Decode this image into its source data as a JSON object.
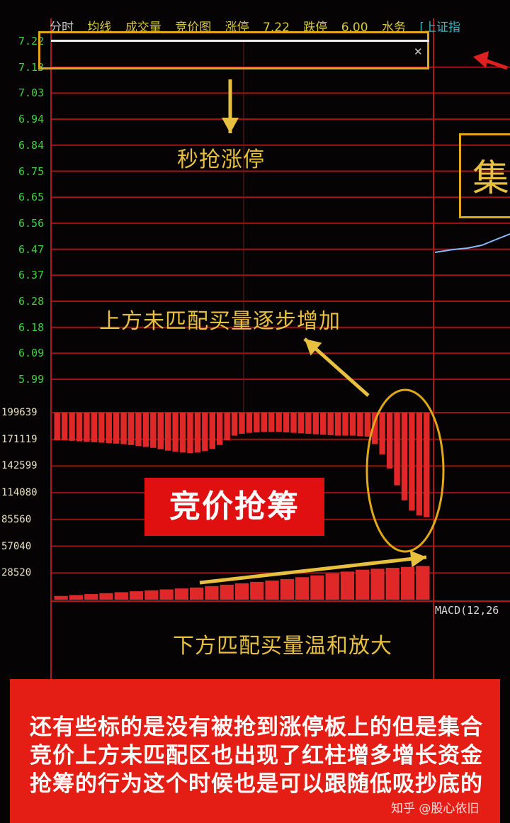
{
  "toolbar": {
    "items": [
      "分时",
      "均线",
      "成交量",
      "竞价图",
      "涨停",
      "7.22",
      "跌停",
      "6.00",
      "水务",
      "[上证指"
    ],
    "first_item": "分时"
  },
  "annotations": {
    "top": "秒抢涨停",
    "middle": "上方未匹配买量逐步增加",
    "bottom": "下方匹配买量温和放大",
    "red_label": "竞价抢筹",
    "right_box": "集"
  },
  "macd_label": "MACD(12,26",
  "caption": [
    "还有些标的是没有被抢到涨停板上的但是集合",
    "竞价上方未匹配区也出现了红柱增多增长资金",
    "抢筹的行为这个时候也是可以跟随低吸抄底的"
  ],
  "watermark": "知乎 @股心依旧",
  "colors": {
    "up_bar": "#e02828",
    "grid": "#c01818",
    "price_axis": "#3fd03f",
    "annotation": "#e8c040",
    "highlight_box": "#e0a818"
  },
  "chart_data": {
    "type": "bar",
    "price_axis_ticks": [
      "7.22",
      "7.13",
      "7.03",
      "6.94",
      "6.84",
      "6.75",
      "6.65",
      "6.56",
      "6.47",
      "6.37",
      "6.28",
      "6.18",
      "6.09",
      "5.99"
    ],
    "volume_axis_ticks": [
      "199639",
      "171119",
      "142599",
      "114080",
      "85560",
      "57040",
      "28520"
    ],
    "unmatched_buy_volume": [
      170000,
      170000,
      169500,
      169000,
      168500,
      168000,
      167500,
      167000,
      166500,
      166000,
      165000,
      164000,
      163000,
      162000,
      160500,
      159000,
      158000,
      157000,
      156500,
      157000,
      158500,
      161000,
      165000,
      170000,
      175000,
      177000,
      178000,
      178500,
      179000,
      179000,
      179000,
      178500,
      178000,
      177500,
      177000,
      176500,
      176000,
      175500,
      175000,
      175000,
      175000,
      174500,
      174000,
      166000,
      155000,
      140000,
      122000,
      106000,
      95000,
      90000,
      88000
    ],
    "matched_buy_volume": [
      4000,
      5000,
      6000,
      7000,
      8000,
      9000,
      10000,
      11000,
      12000,
      13000,
      14500,
      16000,
      17500,
      19000,
      20500,
      22000,
      24000,
      26000,
      28000,
      30000,
      32000,
      33000,
      34000,
      35000,
      36000
    ]
  }
}
